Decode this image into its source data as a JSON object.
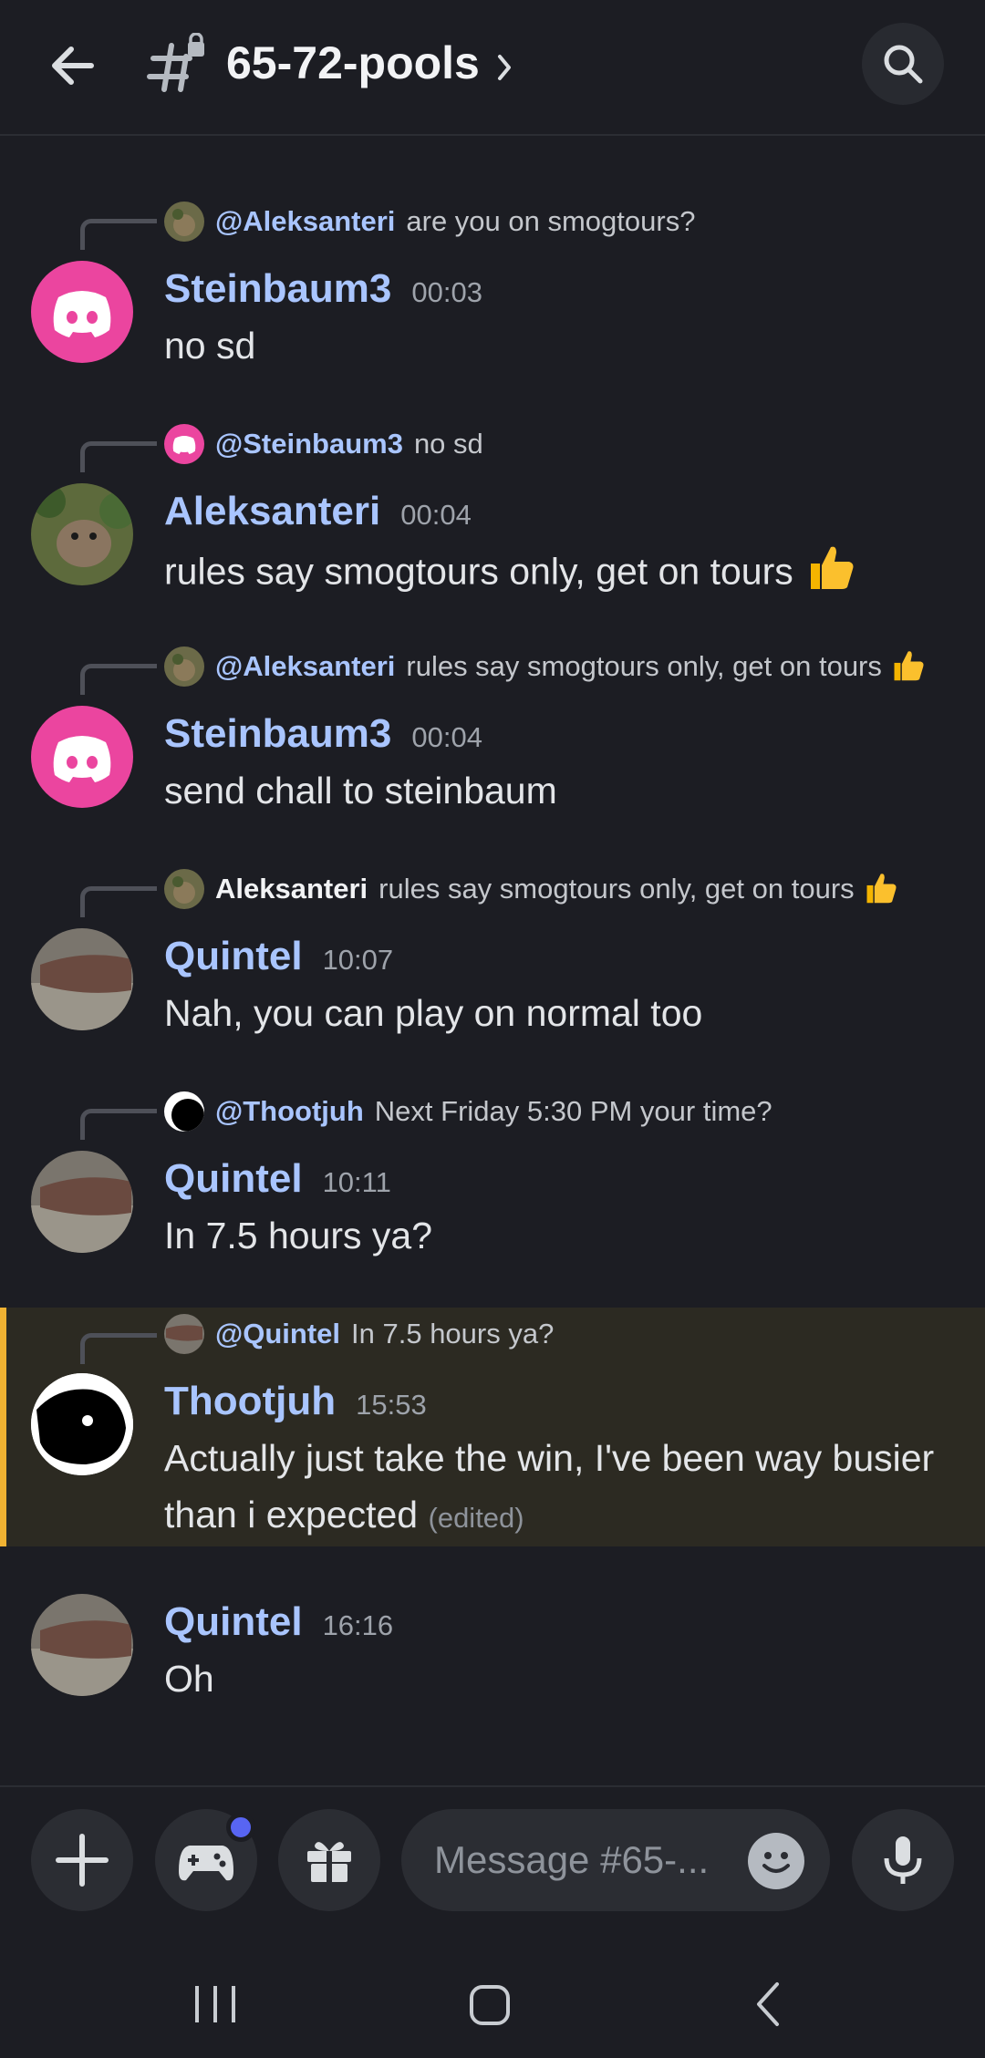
{
  "header": {
    "channel_name": "65-72-pools",
    "back_icon": "arrow-left-icon",
    "channel_icon": "locked-hashtag-icon",
    "search_icon": "search-icon"
  },
  "messages": [
    {
      "reply_to": {
        "name": "@Aleksanteri",
        "text": "are you on smogtours?"
      },
      "author": "Steinbaum3",
      "time": "00:03",
      "text": "no sd"
    },
    {
      "reply_to": {
        "name": "@Steinbaum3",
        "text": "no sd"
      },
      "author": "Aleksanteri",
      "time": "00:04",
      "text": "rules say smogtours only, get on tours"
    },
    {
      "reply_to": {
        "name": "@Aleksanteri",
        "text": "rules say smogtours only, get on tours"
      },
      "author": "Steinbaum3",
      "time": "00:04",
      "text": "send chall to steinbaum"
    },
    {
      "reply_to": {
        "name": "Aleksanteri",
        "text": "rules say smogtours only, get on tours"
      },
      "author": "Quintel",
      "time": "10:07",
      "text": "Nah, you can play on normal too"
    },
    {
      "reply_to": {
        "name": "@Thootjuh",
        "text": "Next Friday 5:30 PM your time?"
      },
      "author": "Quintel",
      "time": "10:11",
      "text": "In 7.5 hours ya?"
    },
    {
      "reply_to": {
        "name": "@Quintel",
        "text": "In 7.5 hours ya?"
      },
      "author": "Thootjuh",
      "time": "15:53",
      "text": "Actually just take the win, I've been way busier than i expected",
      "edited": "(edited)"
    },
    {
      "author": "Quintel",
      "time": "16:16",
      "text": "Oh"
    }
  ],
  "composer": {
    "placeholder": "Message #65-...",
    "icons": [
      "plus-icon",
      "gamepad-icon",
      "gift-icon",
      "emoji-icon",
      "microphone-icon"
    ],
    "accent": "#5865f2"
  },
  "colors": {
    "background": "#1c1d23",
    "username": "#a9c5ff",
    "highlight_bar": "#f0b232",
    "discord_pink": "#eb459f"
  }
}
